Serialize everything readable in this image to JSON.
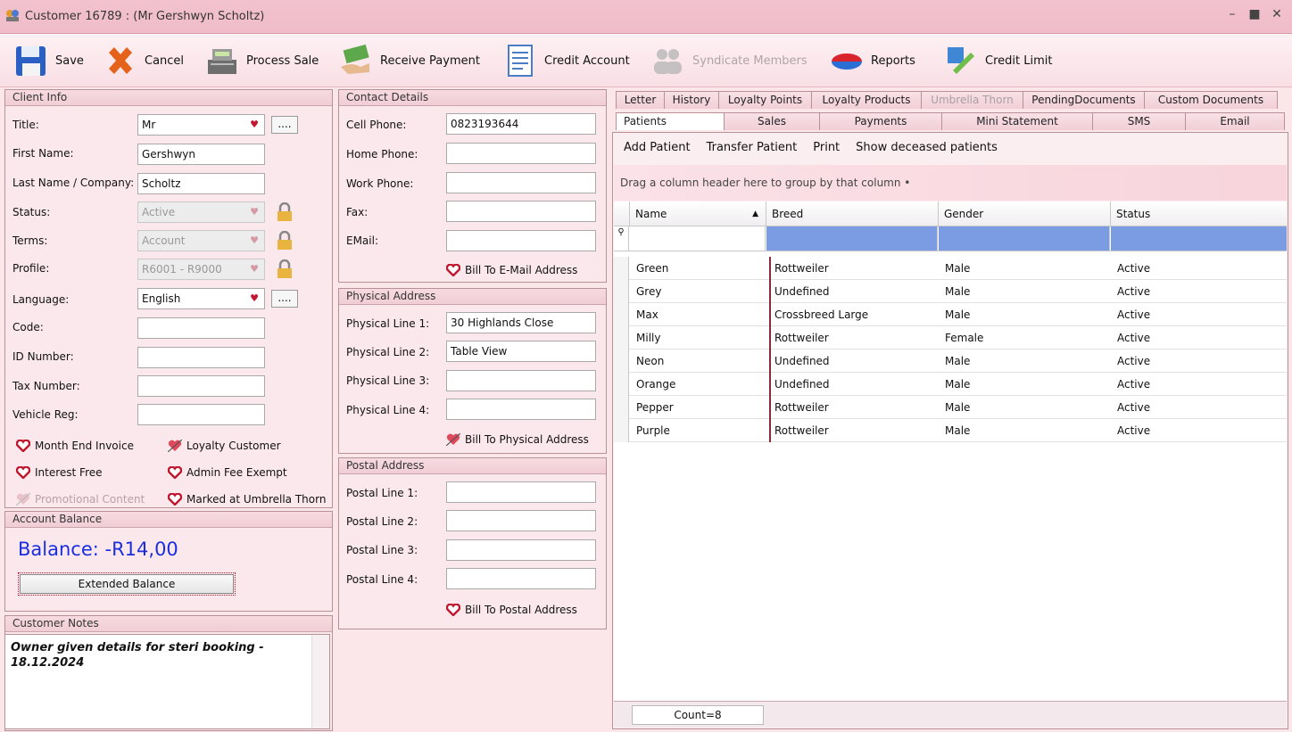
{
  "window": {
    "title": "Customer 16789 : (Mr Gershwyn  Scholtz)",
    "minimize": "–",
    "maximize": "■",
    "close": "✕"
  },
  "toolbar": {
    "save": "Save",
    "cancel": "Cancel",
    "process_sale": "Process Sale",
    "receive_payment": "Receive Payment",
    "credit_account": "Credit Account",
    "syndicate_members": "Syndicate Members",
    "reports": "Reports",
    "credit_limit": "Credit Limit"
  },
  "client_info": {
    "header": "Client Info",
    "title_label": "Title:",
    "title_value": "Mr",
    "first_name_label": "First Name:",
    "first_name_value": "Gershwyn",
    "last_name_label": "Last Name / Company:",
    "last_name_value": "Scholtz",
    "status_label": "Status:",
    "status_value": "Active",
    "terms_label": "Terms:",
    "terms_value": "Account",
    "profile_label": "Profile:",
    "profile_value": "R6001 - R9000",
    "language_label": "Language:",
    "language_value": "English",
    "code_label": "Code:",
    "id_label": "ID Number:",
    "tax_label": "Tax Number:",
    "vehicle_label": "Vehicle Reg:",
    "ellipsis": "....",
    "month_end_invoice": "Month End Invoice",
    "loyalty_customer": "Loyalty Customer",
    "interest_free": "Interest Free",
    "admin_fee_exempt": "Admin Fee Exempt",
    "promotional_content": "Promotional Content",
    "marked_at": "Marked at Umbrella Thorn"
  },
  "account_balance": {
    "header": "Account Balance",
    "balance": "Balance: -R14,00",
    "extended_button": "Extended Balance"
  },
  "customer_notes": {
    "header": "Customer Notes",
    "text": "Owner given details for steri booking - 18.12.2024"
  },
  "contact": {
    "header": "Contact Details",
    "cell_label": "Cell Phone:",
    "cell_value": "0823193644",
    "home_label": "Home Phone:",
    "work_label": "Work Phone:",
    "fax_label": "Fax:",
    "email_label": "EMail:",
    "bill_email": "Bill To E-Mail Address"
  },
  "physical": {
    "header": "Physical Address",
    "line1_label": "Physical Line 1:",
    "line1_value": "30 Highlands Close",
    "line2_label": "Physical Line 2:",
    "line2_value": "Table View",
    "line3_label": "Physical Line 3:",
    "line4_label": "Physical Line 4:",
    "bill": "Bill To Physical Address"
  },
  "postal": {
    "header": "Postal Address",
    "line1_label": "Postal Line 1:",
    "line2_label": "Postal Line 2:",
    "line3_label": "Postal Line 3:",
    "line4_label": "Postal Line 4:",
    "bill": "Bill To Postal Address"
  },
  "tabs_row1": [
    "Letter",
    "History",
    "Loyalty Points",
    "Loyalty Products",
    "Umbrella Thorn",
    "PendingDocuments",
    "Custom Documents"
  ],
  "tabs_row2": [
    "Patients",
    "Sales",
    "Payments",
    "Mini Statement",
    "SMS",
    "Email"
  ],
  "patients": {
    "menu": [
      "Add Patient",
      "Transfer Patient",
      "Print",
      "Show deceased patients"
    ],
    "group_hint": "Drag a column header here to group by that column",
    "columns": [
      "Name",
      "Breed",
      "Gender",
      "Status"
    ],
    "rows": [
      [
        "Green",
        "Rottweiler",
        "Male",
        "Active"
      ],
      [
        "Grey",
        "Undefined",
        "Male",
        "Active"
      ],
      [
        "Max",
        "Crossbreed Large",
        "Male",
        "Active"
      ],
      [
        "Milly",
        "Rottweiler",
        "Female",
        "Active"
      ],
      [
        "Neon",
        "Undefined",
        "Male",
        "Active"
      ],
      [
        "Orange",
        "Undefined",
        "Male",
        "Active"
      ],
      [
        "Pepper",
        "Rottweiler",
        "Male",
        "Active"
      ],
      [
        "Purple",
        "Rottweiler",
        "Male",
        "Active"
      ]
    ],
    "count": "Count=8"
  },
  "colors": {
    "accent": "#c0172f",
    "balance": "#1a2ee0",
    "filter_row": "#7b9be3"
  }
}
